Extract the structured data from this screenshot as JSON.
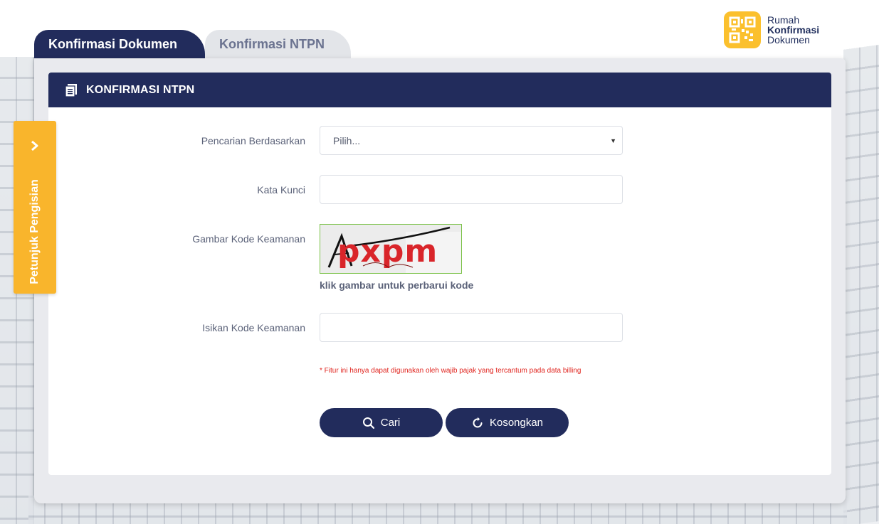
{
  "logo": {
    "line1": "Rumah",
    "line2": "Konfirmasi",
    "line3": "Dokumen",
    "icon": "qr-code-icon"
  },
  "tabs": [
    {
      "label": "Konfirmasi Dokumen",
      "active": true
    },
    {
      "label": "Konfirmasi NTPN",
      "active": false
    }
  ],
  "side_tab": {
    "label": "Petunjuk Pengisian",
    "icon": "chevron-right-icon"
  },
  "panel": {
    "title": "KONFIRMASI NTPN",
    "icon": "document-icon"
  },
  "form": {
    "search_by": {
      "label": "Pencarian Berdasarkan",
      "selected": "Pilih..."
    },
    "keyword": {
      "label": "Kata Kunci",
      "value": ""
    },
    "captcha_image": {
      "label": "Gambar Kode Keamanan",
      "text": "pxpm",
      "hint": "klik gambar untuk perbarui kode"
    },
    "captcha_input": {
      "label": "Isikan Kode Keamanan",
      "value": ""
    },
    "note": "* Fitur ini hanya dapat digunakan oleh wajib pajak yang tercantum pada data billing"
  },
  "buttons": {
    "search": {
      "label": "Cari",
      "icon": "search-icon"
    },
    "reset": {
      "label": "Kosongkan",
      "icon": "refresh-icon"
    }
  },
  "colors": {
    "navy": "#222c5c",
    "accent": "#f9b52c",
    "error": "#e0241e"
  }
}
